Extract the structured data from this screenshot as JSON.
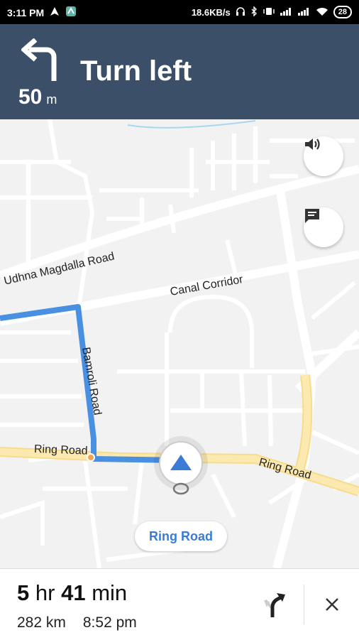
{
  "status_bar": {
    "time": "3:11 PM",
    "network_speed": "18.6KB/s",
    "battery": "28"
  },
  "navigation": {
    "instruction": "Turn left",
    "distance_value": "50",
    "distance_unit": "m",
    "turn_icon": "turn-left-arrow-icon"
  },
  "map": {
    "road_labels": {
      "udhna": "Udhna Magdalla Road",
      "canal": "Canal Corridor",
      "bamroli": "Bamroli Road",
      "ring_left": "Ring Road",
      "ring_right": "Ring Road"
    },
    "current_road": "Ring Road",
    "colors": {
      "route": "#4a90e2",
      "highway": "#fbe6a2",
      "road": "#ffffff",
      "background": "#f2f2f2"
    }
  },
  "trip": {
    "hours": "5",
    "hr_label": "hr",
    "minutes": "41",
    "min_label": "min",
    "distance": "282 km",
    "arrival": "8:52 pm"
  },
  "colors": {
    "header": "#3b5068"
  }
}
